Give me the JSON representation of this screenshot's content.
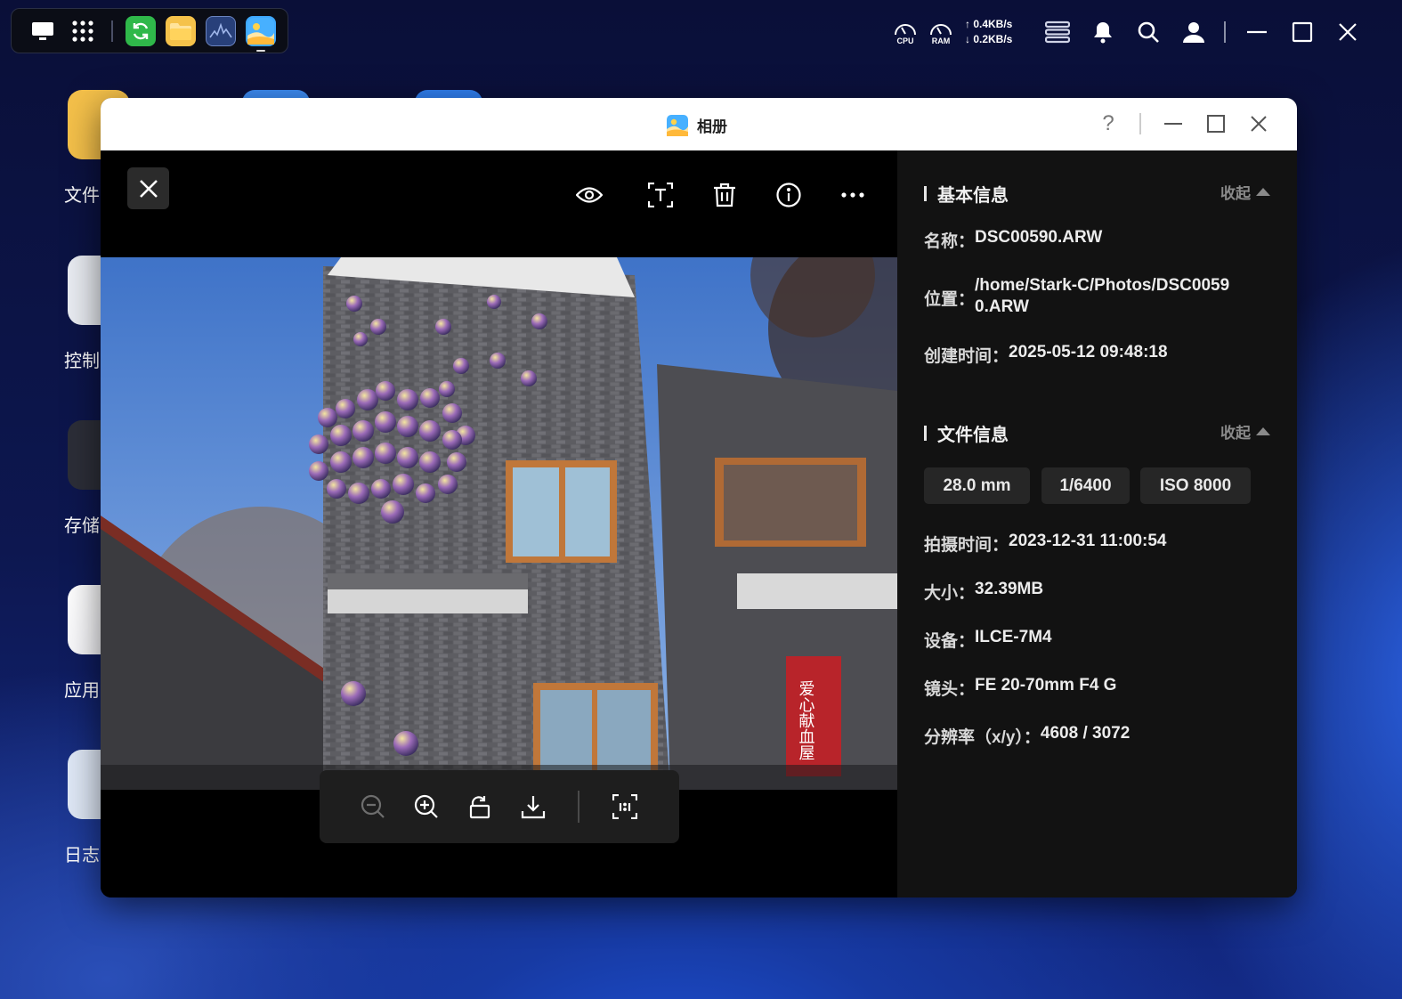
{
  "taskbar": {
    "apps": [
      {
        "name": "show-desktop"
      },
      {
        "name": "app-launcher"
      },
      {
        "name": "sync-app"
      },
      {
        "name": "file-manager"
      },
      {
        "name": "resource-monitor"
      },
      {
        "name": "photos"
      }
    ]
  },
  "system_tray": {
    "cpu_label": "CPU",
    "ram_label": "RAM",
    "upload_speed": "↑ 0.4KB/s",
    "download_speed": "↓ 0.2KB/s"
  },
  "desktop": {
    "icons": [
      {
        "label": "文件"
      },
      {
        "label": "控制"
      },
      {
        "label": "存储"
      },
      {
        "label": "应用"
      },
      {
        "label": "日志"
      }
    ]
  },
  "window": {
    "title": "相册",
    "help_glyph": "?"
  },
  "viewer": {
    "toolbar_icons": [
      "eye-icon",
      "text-recognition-icon",
      "trash-icon",
      "info-icon",
      "more-icon"
    ],
    "zoombar_icons": [
      "zoom-out-icon",
      "zoom-in-icon",
      "rotate-icon",
      "download-icon",
      "actual-size-icon"
    ],
    "shop_sign": "爱心献血屋"
  },
  "info_panel": {
    "basic": {
      "title": "基本信息",
      "collapse": "收起",
      "name_label": "名称：",
      "name_value": "DSC00590.ARW",
      "location_label": "位置：",
      "location_value_line1": "/home/Stark-C/Photos/DSC0059",
      "location_value_line2": "0.ARW",
      "created_label": "创建时间：",
      "created_value": "2025-05-12 09:48:18"
    },
    "file": {
      "title": "文件信息",
      "collapse": "收起",
      "focal_length": "28.0 mm",
      "shutter": "1/6400",
      "iso": "ISO 8000",
      "taken_label": "拍摄时间：",
      "taken_value": "2023-12-31 11:00:54",
      "size_label": "大小：",
      "size_value": "32.39MB",
      "device_label": "设备：",
      "device_value": "ILCE-7M4",
      "lens_label": "镜头：",
      "lens_value": "FE 20-70mm F4 G",
      "resolution_label": "分辨率（x/y）：",
      "resolution_value": "4608 / 3072"
    }
  },
  "colors": {
    "panel_bg": "#121212",
    "viewer_bg": "#000000",
    "pill_bg": "#262626",
    "titlebar_bg": "#ffffff"
  }
}
